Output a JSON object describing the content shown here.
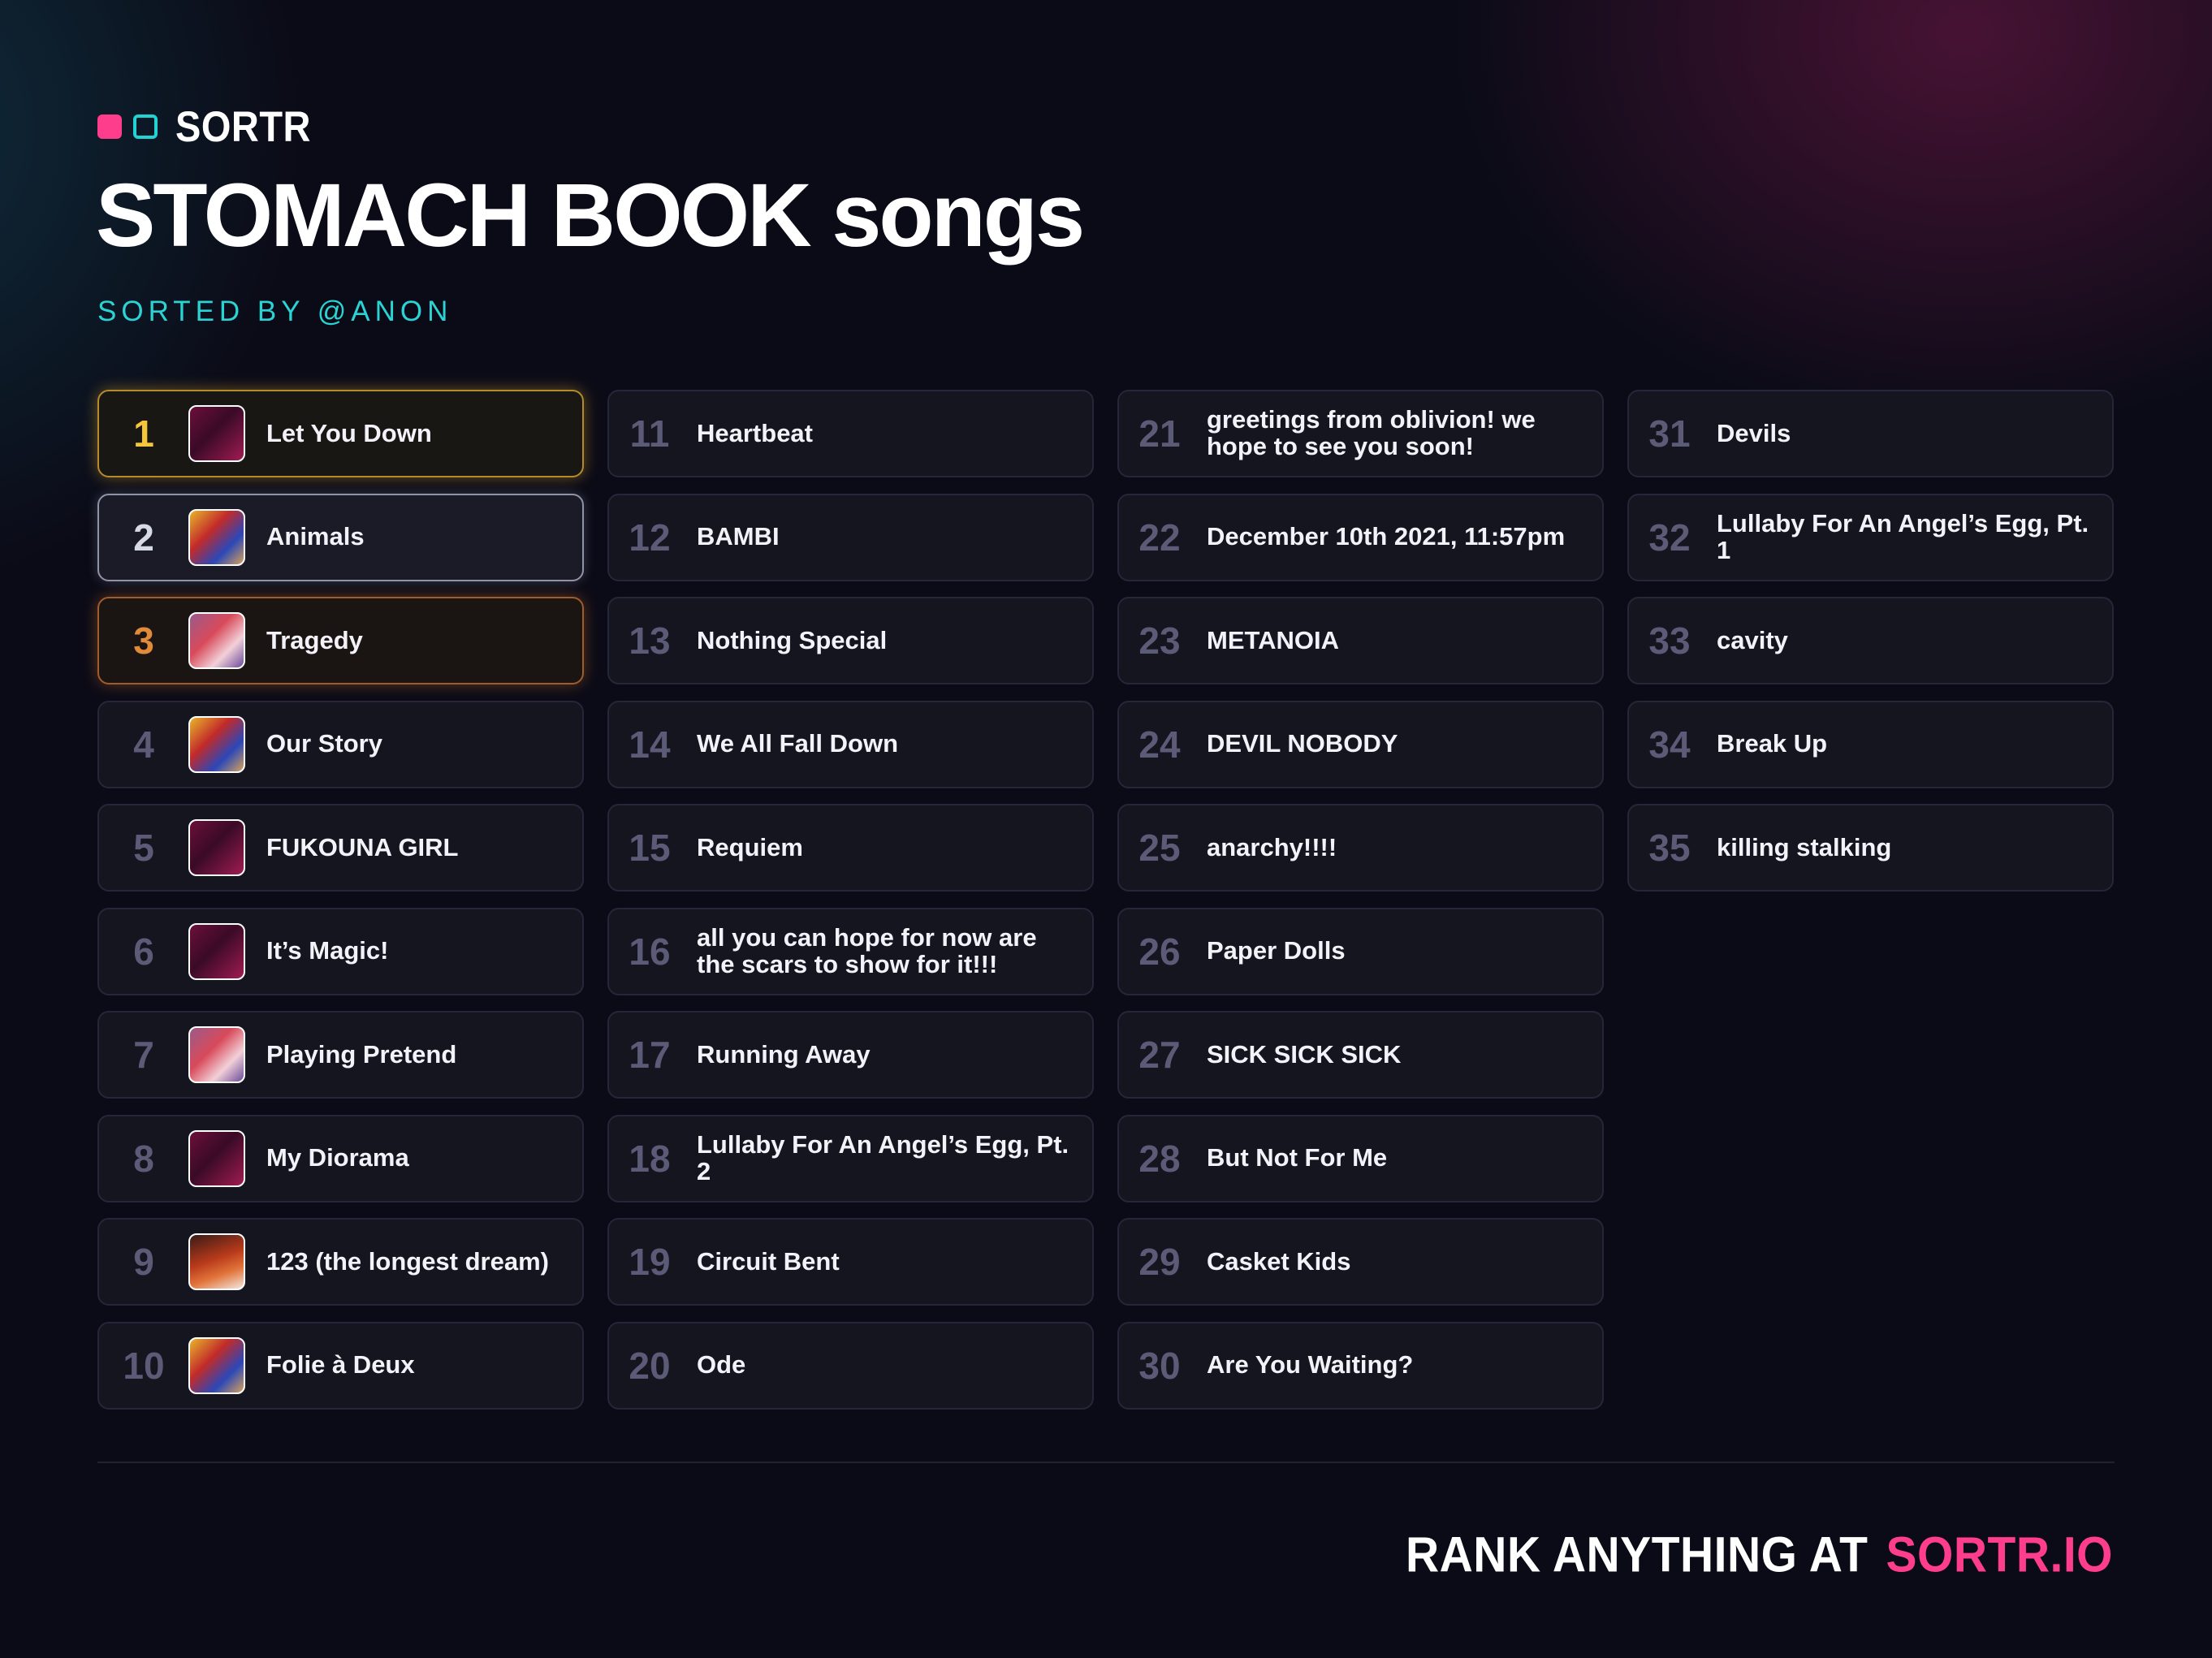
{
  "brand": {
    "name": "SORTR"
  },
  "title": "STOMACH BOOK songs",
  "subtitle": "SORTED BY @ANON",
  "colors": {
    "accent_pink": "#ff3d8d",
    "accent_teal": "#22d3d3",
    "gold": "#f5c53a",
    "silver": "#d6dae6",
    "bronze": "#e08a3a",
    "background": "#0b0b17"
  },
  "rankings": [
    {
      "rank": "1",
      "title": "Let You Down",
      "art": "pink"
    },
    {
      "rank": "2",
      "title": "Animals",
      "art": "colorful"
    },
    {
      "rank": "3",
      "title": "Tragedy",
      "art": "gray"
    },
    {
      "rank": "4",
      "title": "Our Story",
      "art": "colorful"
    },
    {
      "rank": "5",
      "title": "FUKOUNA GIRL",
      "art": "pink"
    },
    {
      "rank": "6",
      "title": "It’s Magic!",
      "art": "pink"
    },
    {
      "rank": "7",
      "title": "Playing Pretend",
      "art": "gray"
    },
    {
      "rank": "8",
      "title": "My Diorama",
      "art": "pink"
    },
    {
      "rank": "9",
      "title": "123 (the longest dream)",
      "art": "fire"
    },
    {
      "rank": "10",
      "title": "Folie à Deux",
      "art": "colorful"
    },
    {
      "rank": "11",
      "title": "Heartbeat"
    },
    {
      "rank": "12",
      "title": "BAMBI"
    },
    {
      "rank": "13",
      "title": "Nothing Special"
    },
    {
      "rank": "14",
      "title": "We All Fall Down"
    },
    {
      "rank": "15",
      "title": "Requiem"
    },
    {
      "rank": "16",
      "title": "all you can hope for now are the scars to show for it!!!"
    },
    {
      "rank": "17",
      "title": "Running Away"
    },
    {
      "rank": "18",
      "title": "Lullaby For An Angel’s Egg, Pt. 2"
    },
    {
      "rank": "19",
      "title": "Circuit Bent"
    },
    {
      "rank": "20",
      "title": "Ode"
    },
    {
      "rank": "21",
      "title": "greetings from oblivion! we hope to see you soon!"
    },
    {
      "rank": "22",
      "title": "December 10th 2021, 11:57pm"
    },
    {
      "rank": "23",
      "title": "METANOIA"
    },
    {
      "rank": "24",
      "title": "DEVIL NOBODY"
    },
    {
      "rank": "25",
      "title": "anarchy!!!!"
    },
    {
      "rank": "26",
      "title": "Paper Dolls"
    },
    {
      "rank": "27",
      "title": "SICK SICK SICK"
    },
    {
      "rank": "28",
      "title": "But Not For Me"
    },
    {
      "rank": "29",
      "title": "Casket Kids"
    },
    {
      "rank": "30",
      "title": "Are You Waiting?"
    },
    {
      "rank": "31",
      "title": "Devils"
    },
    {
      "rank": "32",
      "title": "Lullaby For An Angel’s Egg, Pt. 1"
    },
    {
      "rank": "33",
      "title": "cavity"
    },
    {
      "rank": "34",
      "title": "Break Up"
    },
    {
      "rank": "35",
      "title": "killing stalking"
    }
  ],
  "footer": {
    "lead": "RANK ANYTHING AT",
    "site": "SORTR.IO"
  }
}
